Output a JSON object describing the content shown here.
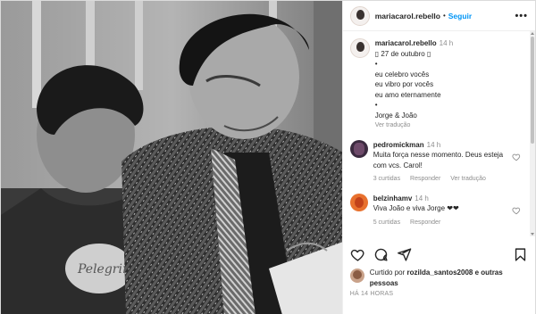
{
  "header": {
    "username": "mariacarol.rebello",
    "separator": "•",
    "follow_label": "Seguir",
    "more_label": "•••"
  },
  "caption": {
    "username": "mariacarol.rebello",
    "time": "14 h",
    "lines": [
      "▯ 27 de outubro ▯",
      "•",
      "eu celebro vocês",
      "eu vibro por vocês",
      "eu amo eternamente",
      "•",
      "Jorge & João"
    ],
    "see_translation": "Ver tradução"
  },
  "comments": [
    {
      "username": "pedromickman",
      "time": "14 h",
      "text": "Muita força nesse momento. Deus esteja com vcs. Carol!",
      "likes": "3 curtidas",
      "reply": "Responder",
      "translate": "Ver tradução"
    },
    {
      "username": "belzinhamv",
      "time": "14 h",
      "text": "Viva João e viva Jorge ❤❤",
      "likes": "5 curtidas",
      "reply": "Responder"
    }
  ],
  "actions": {
    "like_icon": "heart-icon",
    "comment_icon": "comment-icon",
    "share_icon": "share-icon",
    "save_icon": "bookmark-icon"
  },
  "liked_by": {
    "prefix": "Curtido por",
    "user": "rozilda_santos2008",
    "suffix": "e outras pessoas"
  },
  "time_ago": "HÁ 14 HORAS",
  "colors": {
    "link_blue": "#0095f6",
    "text": "#262626",
    "muted": "#8e8e8e"
  }
}
